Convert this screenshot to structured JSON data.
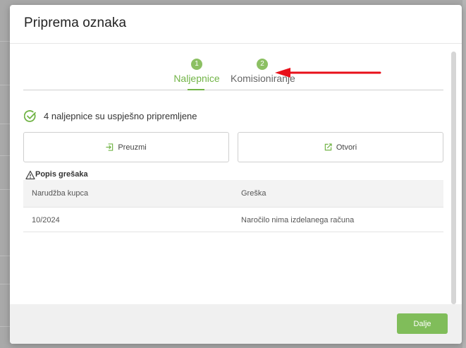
{
  "modal": {
    "title": "Priprema oznaka"
  },
  "steps": [
    {
      "number": "1",
      "label": "Naljepnice",
      "active": true
    },
    {
      "number": "2",
      "label": "Komisioniranje",
      "active": false
    }
  ],
  "success": {
    "text": "4 naljepnice su uspješno pripremljene",
    "icon": "check-circle-icon"
  },
  "buttons": {
    "download_label": "Preuzmi",
    "download_icon": "sign-in-icon",
    "open_label": "Otvori",
    "open_icon": "external-edit-icon"
  },
  "errors": {
    "title": "Popis grešaka",
    "icon": "warning-icon",
    "columns": [
      "Narudžba kupca",
      "Greška"
    ],
    "rows": [
      {
        "order": "10/2024",
        "error": "Naročilo nima izdelanega računa"
      }
    ]
  },
  "footer": {
    "next_label": "Dalje"
  },
  "colors": {
    "accent": "#72b447",
    "accent_button": "#80bd5a",
    "annotation_arrow": "#e8101a"
  }
}
